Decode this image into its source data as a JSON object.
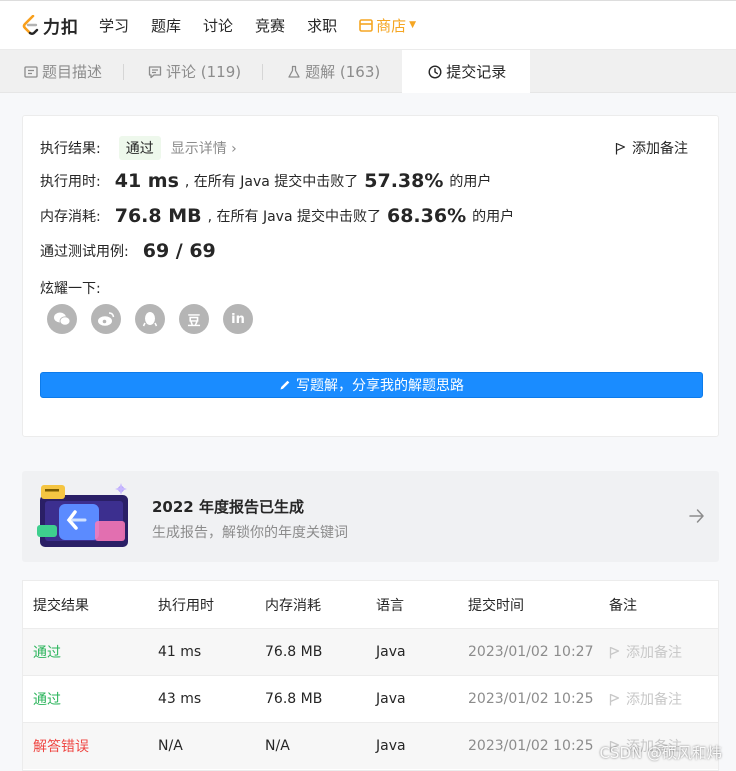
{
  "nav": {
    "logo_text": "力扣",
    "items": [
      "学习",
      "题库",
      "讨论",
      "竞赛",
      "求职"
    ],
    "shop": "商店"
  },
  "tabs": [
    {
      "label": "题目描述",
      "icon": "document-icon"
    },
    {
      "label": "评论 (119)",
      "icon": "comment-icon"
    },
    {
      "label": "题解 (163)",
      "icon": "flask-icon"
    },
    {
      "label": "提交记录",
      "icon": "clock-icon",
      "active": true
    }
  ],
  "result": {
    "status_label": "执行结果:",
    "status": "通过",
    "detail": "显示详情",
    "add_note": "添加备注",
    "time_label": "执行用时:",
    "time_value": "41 ms",
    "time_text": ", 在所有 Java 提交中击败了",
    "time_pct": "57.38%",
    "users_suffix": "的用户",
    "mem_label": "内存消耗:",
    "mem_value": "76.8 MB",
    "mem_text": ", 在所有 Java 提交中击败了",
    "mem_pct": "68.36%",
    "cases_label": "通过测试用例:",
    "cases_value": "69 / 69",
    "share_label": "炫耀一下:",
    "share_icons": [
      "wechat-icon",
      "weibo-icon",
      "qq-icon",
      "douban-icon",
      "linkedin-icon"
    ],
    "douban_glyph": "豆",
    "linkedin_glyph": "in",
    "write_button": "写题解，分享我的解题思路"
  },
  "banner": {
    "title": "2022 年度报告已生成",
    "subtitle": "生成报告，解锁你的年度关键词"
  },
  "table": {
    "headers": [
      "提交结果",
      "执行用时",
      "内存消耗",
      "语言",
      "提交时间",
      "备注"
    ],
    "rows": [
      {
        "result": "通过",
        "time": "41 ms",
        "mem": "76.8 MB",
        "lang": "Java",
        "submitted": "2023/01/02 10:27",
        "note": "添加备注",
        "status": "ok"
      },
      {
        "result": "通过",
        "time": "43 ms",
        "mem": "76.8 MB",
        "lang": "Java",
        "submitted": "2023/01/02 10:25",
        "note": "添加备注",
        "status": "ok"
      },
      {
        "result": "解答错误",
        "time": "N/A",
        "mem": "N/A",
        "lang": "Java",
        "submitted": "2023/01/02 10:25",
        "note": "添加备注",
        "status": "err"
      }
    ]
  },
  "watermark": "CSDN @硕风和炜",
  "colors": {
    "accent": "#1a8cff",
    "success": "#2db55d",
    "error": "#ef4743",
    "shop": "#f5a623"
  }
}
